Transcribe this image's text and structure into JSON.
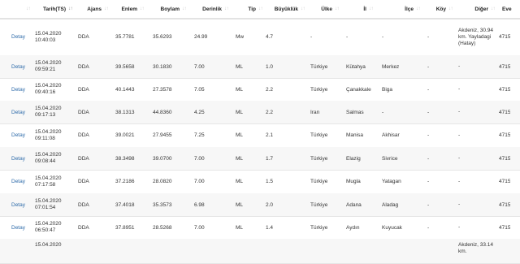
{
  "headers": {
    "blank": "",
    "tarih": "Tarih(TS)",
    "ajans": "Ajans",
    "enlem": "Enlem",
    "boylam": "Boylam",
    "derinlik": "Derinlik",
    "tip": "Tip",
    "buyukluk": "Büyüklük",
    "ulke": "Ülke",
    "il": "İl",
    "ilce": "İlçe",
    "koy": "Köy",
    "diger": "Diğer",
    "event": "Eve"
  },
  "sort_glyph": "↓↑",
  "rows": [
    {
      "link": "Detay",
      "date": "15.04.2020",
      "time": "10:40:03",
      "ajans": "DDA",
      "enlem": "35.7781",
      "boylam": "35.6293",
      "derinlik": "24.99",
      "tip": "Mw",
      "buyukluk": "4.7",
      "ulke": "-",
      "il": "-",
      "ilce": "-",
      "koy": "-",
      "diger": "Akdeniz, 30.94 km. Yayladagi (Hatay)",
      "event": "4715"
    },
    {
      "link": "Detay",
      "date": "15.04.2020",
      "time": "09:59:21",
      "ajans": "DDA",
      "enlem": "39.5658",
      "boylam": "30.1830",
      "derinlik": "7.00",
      "tip": "ML",
      "buyukluk": "1.0",
      "ulke": "Türkiye",
      "il": "Kütahya",
      "ilce": "Merkez",
      "koy": "-",
      "diger": "-",
      "event": "4715"
    },
    {
      "link": "Detay",
      "date": "15.04.2020",
      "time": "09:40:16",
      "ajans": "DDA",
      "enlem": "40.1443",
      "boylam": "27.3578",
      "derinlik": "7.05",
      "tip": "ML",
      "buyukluk": "2.2",
      "ulke": "Türkiye",
      "il": "Çanakkale",
      "ilce": "Biga",
      "koy": "-",
      "diger": "-",
      "event": "4715"
    },
    {
      "link": "Detay",
      "date": "15.04.2020",
      "time": "09:17:13",
      "ajans": "DDA",
      "enlem": "38.1313",
      "boylam": "44.8360",
      "derinlik": "4.25",
      "tip": "ML",
      "buyukluk": "2.2",
      "ulke": "Iran",
      "il": "Salmas",
      "ilce": "-",
      "koy": "-",
      "diger": "-",
      "event": "4715"
    },
    {
      "link": "Detay",
      "date": "15.04.2020",
      "time": "09:11:08",
      "ajans": "DDA",
      "enlem": "39.0021",
      "boylam": "27.9455",
      "derinlik": "7.25",
      "tip": "ML",
      "buyukluk": "2.1",
      "ulke": "Türkiye",
      "il": "Manisa",
      "ilce": "Akhisar",
      "koy": "-",
      "diger": "-",
      "event": "4715"
    },
    {
      "link": "Detay",
      "date": "15.04.2020",
      "time": "09:08:44",
      "ajans": "DDA",
      "enlem": "38.3498",
      "boylam": "39.0700",
      "derinlik": "7.00",
      "tip": "ML",
      "buyukluk": "1.7",
      "ulke": "Türkiye",
      "il": "Elazig",
      "ilce": "Sivrice",
      "koy": "-",
      "diger": "-",
      "event": "4715"
    },
    {
      "link": "Detay",
      "date": "15.04.2020",
      "time": "07:17:58",
      "ajans": "DDA",
      "enlem": "37.2186",
      "boylam": "28.0820",
      "derinlik": "7.00",
      "tip": "ML",
      "buyukluk": "1.5",
      "ulke": "Türkiye",
      "il": "Mugla",
      "ilce": "Yatagan",
      "koy": "-",
      "diger": "-",
      "event": "4715"
    },
    {
      "link": "Detay",
      "date": "15.04.2020",
      "time": "07:01:54",
      "ajans": "DDA",
      "enlem": "37.4018",
      "boylam": "35.3573",
      "derinlik": "6.98",
      "tip": "ML",
      "buyukluk": "2.0",
      "ulke": "Türkiye",
      "il": "Adana",
      "ilce": "Aladag",
      "koy": "-",
      "diger": "-",
      "event": "4715"
    },
    {
      "link": "Detay",
      "date": "15.04.2020",
      "time": "06:50:47",
      "ajans": "DDA",
      "enlem": "37.8951",
      "boylam": "28.5268",
      "derinlik": "7.00",
      "tip": "ML",
      "buyukluk": "1.4",
      "ulke": "Türkiye",
      "il": "Aydın",
      "ilce": "Kuyucak",
      "koy": "-",
      "diger": "-",
      "event": "4715"
    },
    {
      "link": "",
      "date": "15.04.2020",
      "time": "",
      "ajans": "",
      "enlem": "",
      "boylam": "",
      "derinlik": "",
      "tip": "",
      "buyukluk": "",
      "ulke": "",
      "il": "",
      "ilce": "",
      "koy": "",
      "diger": "Akdeniz, 33.14 km.",
      "event": ""
    }
  ]
}
